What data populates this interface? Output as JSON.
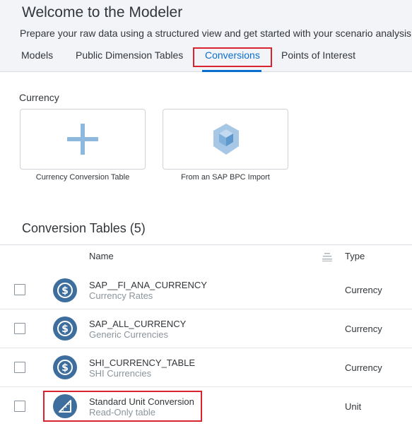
{
  "header": {
    "title": "Welcome to the Modeler",
    "subtitle": "Prepare your raw data using a structured view and get started with your scenario analysis."
  },
  "tabs": [
    {
      "label": "Models"
    },
    {
      "label": "Public Dimension Tables"
    },
    {
      "label": "Conversions",
      "active": true
    },
    {
      "label": "Points of Interest"
    }
  ],
  "create": {
    "section_label": "Currency",
    "tiles": [
      {
        "label": "Currency Conversion Table",
        "icon": "plus-icon"
      },
      {
        "label": "From an SAP BPC Import",
        "icon": "bpc-cube-icon"
      }
    ]
  },
  "conversion_tables": {
    "title": "Conversion Tables (5)",
    "columns": {
      "name": "Name",
      "type": "Type"
    },
    "rows": [
      {
        "name": "SAP__FI_ANA_CURRENCY",
        "description": "Currency Rates",
        "type": "Currency",
        "icon": "currency-dollar-icon"
      },
      {
        "name": "SAP_ALL_CURRENCY",
        "description": "Generic Currencies",
        "type": "Currency",
        "icon": "currency-dollar-icon"
      },
      {
        "name": "SHI_CURRENCY_TABLE",
        "description": "SHI Currencies",
        "type": "Currency",
        "icon": "currency-dollar-icon"
      },
      {
        "name": "Standard Unit Conversion",
        "description": "Read-Only table",
        "type": "Unit",
        "icon": "ruler-triangle-icon"
      }
    ]
  },
  "colors": {
    "accent": "#0a6ed1",
    "highlight": "#d9232e",
    "icon_circle": "#3e6e9d",
    "tile_icon": "#8fb8de"
  }
}
